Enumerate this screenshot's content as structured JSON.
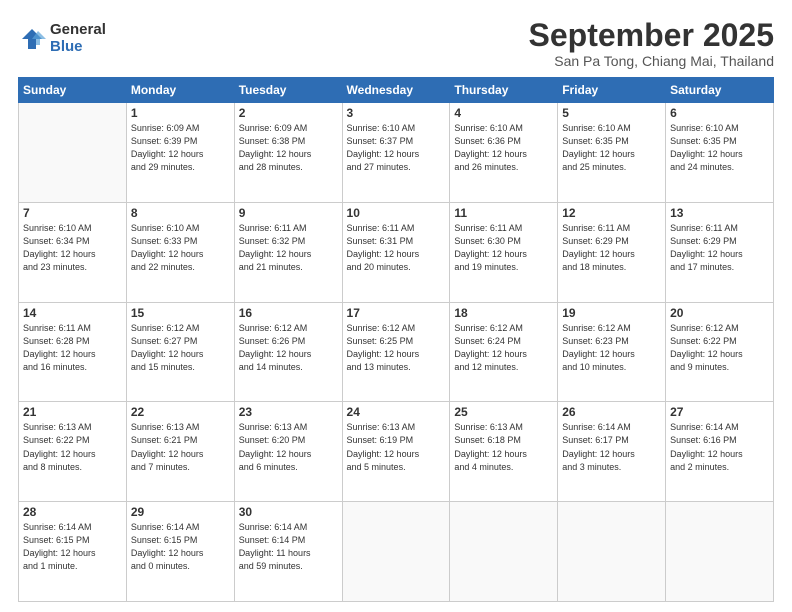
{
  "logo": {
    "general": "General",
    "blue": "Blue"
  },
  "title": "September 2025",
  "subtitle": "San Pa Tong, Chiang Mai, Thailand",
  "days_of_week": [
    "Sunday",
    "Monday",
    "Tuesday",
    "Wednesday",
    "Thursday",
    "Friday",
    "Saturday"
  ],
  "weeks": [
    [
      {
        "day": "",
        "info": ""
      },
      {
        "day": "1",
        "info": "Sunrise: 6:09 AM\nSunset: 6:39 PM\nDaylight: 12 hours\nand 29 minutes."
      },
      {
        "day": "2",
        "info": "Sunrise: 6:09 AM\nSunset: 6:38 PM\nDaylight: 12 hours\nand 28 minutes."
      },
      {
        "day": "3",
        "info": "Sunrise: 6:10 AM\nSunset: 6:37 PM\nDaylight: 12 hours\nand 27 minutes."
      },
      {
        "day": "4",
        "info": "Sunrise: 6:10 AM\nSunset: 6:36 PM\nDaylight: 12 hours\nand 26 minutes."
      },
      {
        "day": "5",
        "info": "Sunrise: 6:10 AM\nSunset: 6:35 PM\nDaylight: 12 hours\nand 25 minutes."
      },
      {
        "day": "6",
        "info": "Sunrise: 6:10 AM\nSunset: 6:35 PM\nDaylight: 12 hours\nand 24 minutes."
      }
    ],
    [
      {
        "day": "7",
        "info": "Sunrise: 6:10 AM\nSunset: 6:34 PM\nDaylight: 12 hours\nand 23 minutes."
      },
      {
        "day": "8",
        "info": "Sunrise: 6:10 AM\nSunset: 6:33 PM\nDaylight: 12 hours\nand 22 minutes."
      },
      {
        "day": "9",
        "info": "Sunrise: 6:11 AM\nSunset: 6:32 PM\nDaylight: 12 hours\nand 21 minutes."
      },
      {
        "day": "10",
        "info": "Sunrise: 6:11 AM\nSunset: 6:31 PM\nDaylight: 12 hours\nand 20 minutes."
      },
      {
        "day": "11",
        "info": "Sunrise: 6:11 AM\nSunset: 6:30 PM\nDaylight: 12 hours\nand 19 minutes."
      },
      {
        "day": "12",
        "info": "Sunrise: 6:11 AM\nSunset: 6:29 PM\nDaylight: 12 hours\nand 18 minutes."
      },
      {
        "day": "13",
        "info": "Sunrise: 6:11 AM\nSunset: 6:29 PM\nDaylight: 12 hours\nand 17 minutes."
      }
    ],
    [
      {
        "day": "14",
        "info": "Sunrise: 6:11 AM\nSunset: 6:28 PM\nDaylight: 12 hours\nand 16 minutes."
      },
      {
        "day": "15",
        "info": "Sunrise: 6:12 AM\nSunset: 6:27 PM\nDaylight: 12 hours\nand 15 minutes."
      },
      {
        "day": "16",
        "info": "Sunrise: 6:12 AM\nSunset: 6:26 PM\nDaylight: 12 hours\nand 14 minutes."
      },
      {
        "day": "17",
        "info": "Sunrise: 6:12 AM\nSunset: 6:25 PM\nDaylight: 12 hours\nand 13 minutes."
      },
      {
        "day": "18",
        "info": "Sunrise: 6:12 AM\nSunset: 6:24 PM\nDaylight: 12 hours\nand 12 minutes."
      },
      {
        "day": "19",
        "info": "Sunrise: 6:12 AM\nSunset: 6:23 PM\nDaylight: 12 hours\nand 10 minutes."
      },
      {
        "day": "20",
        "info": "Sunrise: 6:12 AM\nSunset: 6:22 PM\nDaylight: 12 hours\nand 9 minutes."
      }
    ],
    [
      {
        "day": "21",
        "info": "Sunrise: 6:13 AM\nSunset: 6:22 PM\nDaylight: 12 hours\nand 8 minutes."
      },
      {
        "day": "22",
        "info": "Sunrise: 6:13 AM\nSunset: 6:21 PM\nDaylight: 12 hours\nand 7 minutes."
      },
      {
        "day": "23",
        "info": "Sunrise: 6:13 AM\nSunset: 6:20 PM\nDaylight: 12 hours\nand 6 minutes."
      },
      {
        "day": "24",
        "info": "Sunrise: 6:13 AM\nSunset: 6:19 PM\nDaylight: 12 hours\nand 5 minutes."
      },
      {
        "day": "25",
        "info": "Sunrise: 6:13 AM\nSunset: 6:18 PM\nDaylight: 12 hours\nand 4 minutes."
      },
      {
        "day": "26",
        "info": "Sunrise: 6:14 AM\nSunset: 6:17 PM\nDaylight: 12 hours\nand 3 minutes."
      },
      {
        "day": "27",
        "info": "Sunrise: 6:14 AM\nSunset: 6:16 PM\nDaylight: 12 hours\nand 2 minutes."
      }
    ],
    [
      {
        "day": "28",
        "info": "Sunrise: 6:14 AM\nSunset: 6:15 PM\nDaylight: 12 hours\nand 1 minute."
      },
      {
        "day": "29",
        "info": "Sunrise: 6:14 AM\nSunset: 6:15 PM\nDaylight: 12 hours\nand 0 minutes."
      },
      {
        "day": "30",
        "info": "Sunrise: 6:14 AM\nSunset: 6:14 PM\nDaylight: 11 hours\nand 59 minutes."
      },
      {
        "day": "",
        "info": ""
      },
      {
        "day": "",
        "info": ""
      },
      {
        "day": "",
        "info": ""
      },
      {
        "day": "",
        "info": ""
      }
    ]
  ]
}
